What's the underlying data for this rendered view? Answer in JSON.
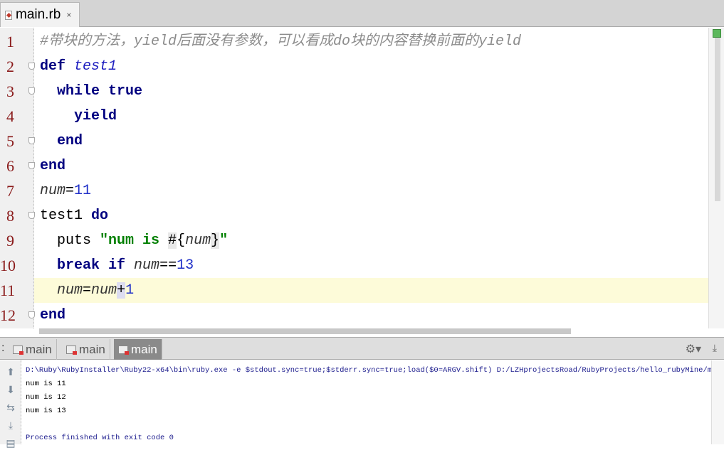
{
  "tab": {
    "label": "main.rb",
    "close": "×"
  },
  "lines": [
    {
      "n": "1",
      "tokens": [
        [
          "cm",
          "#带块的方法，yield后面没有参数，可以看成do块的内容替换前面的yield"
        ]
      ]
    },
    {
      "n": "2",
      "fold": true,
      "tokens": [
        [
          "kw",
          "def "
        ],
        [
          "fn",
          "test1"
        ]
      ]
    },
    {
      "n": "3",
      "fold": true,
      "tokens": [
        [
          "id",
          "  "
        ],
        [
          "kw",
          "while true"
        ]
      ]
    },
    {
      "n": "4",
      "tokens": [
        [
          "id",
          "    "
        ],
        [
          "kw",
          "yield"
        ]
      ]
    },
    {
      "n": "5",
      "fold": true,
      "tokens": [
        [
          "id",
          "  "
        ],
        [
          "kw",
          "end"
        ]
      ]
    },
    {
      "n": "6",
      "fold": true,
      "tokens": [
        [
          "kw",
          "end"
        ]
      ]
    },
    {
      "n": "7",
      "tokens": [
        [
          "var",
          "num"
        ],
        [
          "id",
          "="
        ],
        [
          "num",
          "11"
        ]
      ]
    },
    {
      "n": "8",
      "fold": true,
      "tokens": [
        [
          "id",
          "test1 "
        ],
        [
          "kw",
          "do"
        ]
      ]
    },
    {
      "n": "9",
      "tokens": [
        [
          "id",
          "  puts "
        ],
        [
          "str",
          "\"num is "
        ],
        [
          "hl",
          "#"
        ],
        [
          "id",
          "{"
        ],
        [
          "var",
          "num"
        ],
        [
          "hl",
          "}"
        ],
        [
          "str",
          "\""
        ]
      ]
    },
    {
      "n": "10",
      "tokens": [
        [
          "id",
          "  "
        ],
        [
          "kw",
          "break if "
        ],
        [
          "var",
          "num"
        ],
        [
          "id",
          "=="
        ],
        [
          "num",
          "13"
        ]
      ]
    },
    {
      "n": "11",
      "current": true,
      "tokens": [
        [
          "id",
          "  "
        ],
        [
          "var",
          "num"
        ],
        [
          "id",
          "="
        ],
        [
          "var",
          "num"
        ],
        [
          "caret",
          "+"
        ],
        [
          "num",
          "1"
        ]
      ]
    },
    {
      "n": "12",
      "fold": true,
      "tokens": [
        [
          "kw",
          "end"
        ]
      ]
    }
  ],
  "run": {
    "prefix": ":",
    "tabs": [
      {
        "label": "main"
      },
      {
        "label": "main"
      },
      {
        "label": "main",
        "active": true
      }
    ],
    "gear": "⚙▾",
    "pin": "⤓"
  },
  "console": {
    "buttons": [
      "up-arrow-icon",
      "down-arrow-icon",
      "soft-wrap-icon",
      "scroll-to-end-icon",
      "print-icon"
    ],
    "output": [
      {
        "text": "D:\\Ruby\\RubyInstaller\\Ruby22-x64\\bin\\ruby.exe -e $stdout.sync=true;$stderr.sync=true;load($0=ARGV.shift) D:/LZHprojectsRoad/RubyProjects/hello_rubyMine/main.rb",
        "color": "#1a1a8c"
      },
      {
        "text": "num is 11",
        "color": "#000000"
      },
      {
        "text": "num is 12",
        "color": "#000000"
      },
      {
        "text": "num is 13",
        "color": "#000000"
      },
      {
        "text": "",
        "color": "#000000"
      },
      {
        "text": "Process finished with exit code 0",
        "color": "#1a1a8c"
      }
    ]
  }
}
